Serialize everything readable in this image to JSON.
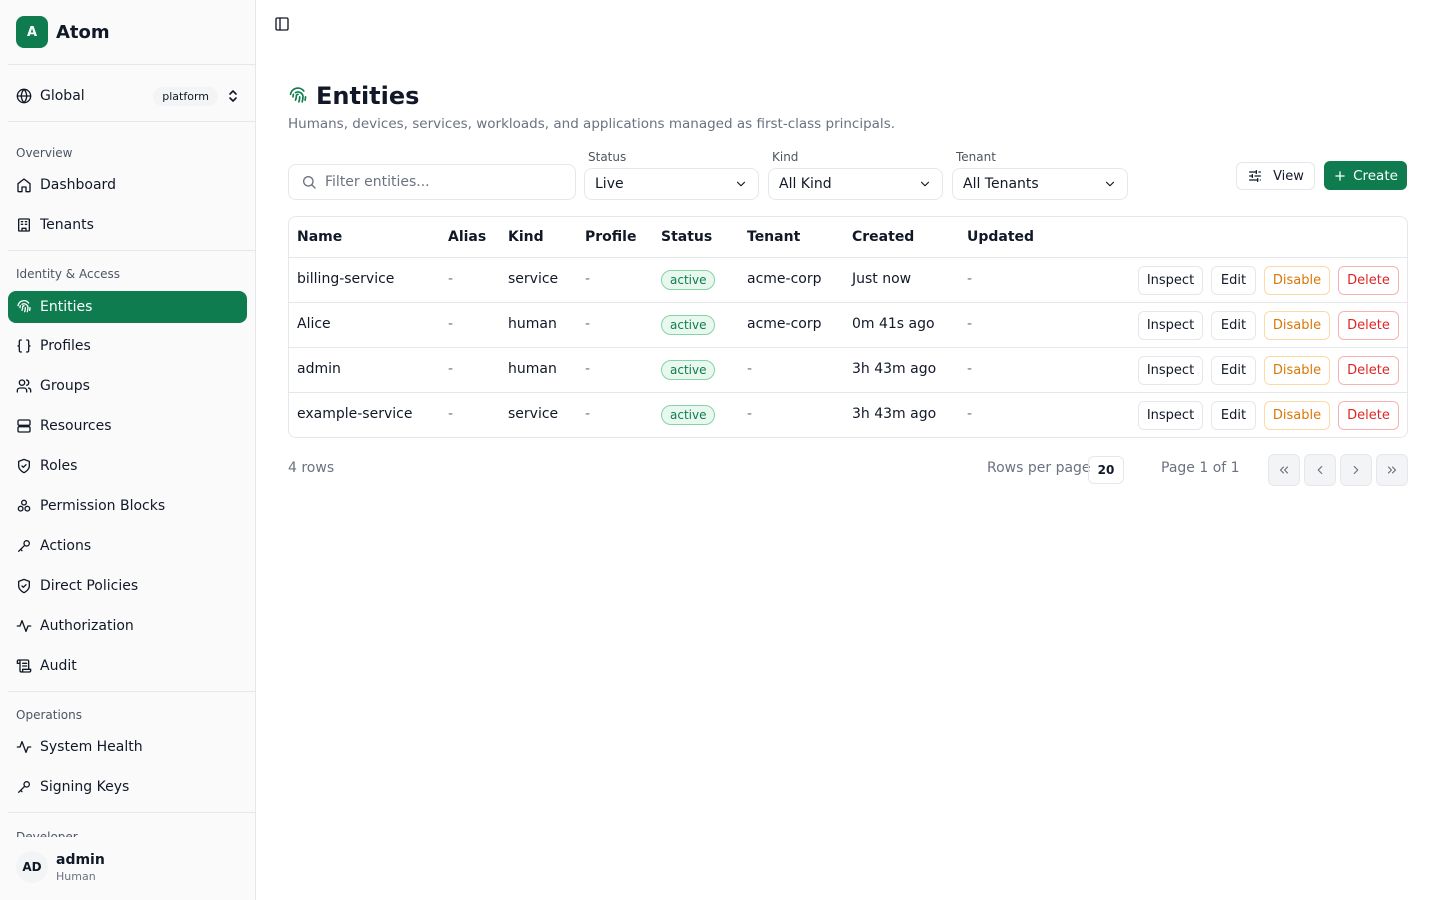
{
  "brand": {
    "logo_letter": "A",
    "name": "Atom"
  },
  "scope": {
    "label": "Global",
    "badge": "platform"
  },
  "sidebar": {
    "overview_title": "Overview",
    "overview": [
      {
        "label": "Dashboard",
        "icon": "home-icon"
      },
      {
        "label": "Tenants",
        "icon": "building-icon"
      }
    ],
    "identity_title": "Identity & Access",
    "identity": [
      {
        "label": "Entities",
        "icon": "fingerprint-icon",
        "active": true
      },
      {
        "label": "Profiles",
        "icon": "braces-icon"
      },
      {
        "label": "Groups",
        "icon": "users-icon"
      },
      {
        "label": "Resources",
        "icon": "server-icon"
      },
      {
        "label": "Roles",
        "icon": "shield-check-icon"
      },
      {
        "label": "Permission Blocks",
        "icon": "blocks-icon"
      },
      {
        "label": "Actions",
        "icon": "key-icon"
      },
      {
        "label": "Direct Policies",
        "icon": "shield-check-icon"
      },
      {
        "label": "Authorization",
        "icon": "activity-icon"
      },
      {
        "label": "Audit",
        "icon": "scroll-icon"
      }
    ],
    "operations_title": "Operations",
    "operations": [
      {
        "label": "System Health",
        "icon": "activity-icon"
      },
      {
        "label": "Signing Keys",
        "icon": "key-icon"
      }
    ],
    "developer_title_partial": "Developer"
  },
  "user": {
    "initials": "AD",
    "name": "admin",
    "kind": "Human"
  },
  "page": {
    "title": "Entities",
    "subtitle": "Humans, devices, services, workloads, and applications managed as first-class principals."
  },
  "filters": {
    "search_placeholder": "Filter entities...",
    "status": {
      "label": "Status",
      "value": "Live"
    },
    "kind": {
      "label": "Kind",
      "value": "All Kind"
    },
    "tenant": {
      "label": "Tenant",
      "value": "All Tenants"
    }
  },
  "toolbar": {
    "view_label": "View",
    "create_label": "Create"
  },
  "table": {
    "columns": [
      "Name",
      "Alias",
      "Kind",
      "Profile",
      "Status",
      "Tenant",
      "Created",
      "Updated"
    ],
    "rows": [
      {
        "name": "billing-service",
        "alias": "-",
        "kind": "service",
        "profile": "-",
        "status": "active",
        "tenant": "acme-corp",
        "created": "Just now",
        "updated": "-"
      },
      {
        "name": "Alice",
        "alias": "-",
        "kind": "human",
        "profile": "-",
        "status": "active",
        "tenant": "acme-corp",
        "created": "0m 41s ago",
        "updated": "-"
      },
      {
        "name": "admin",
        "alias": "-",
        "kind": "human",
        "profile": "-",
        "status": "active",
        "tenant": "-",
        "created": "3h 43m ago",
        "updated": "-"
      },
      {
        "name": "example-service",
        "alias": "-",
        "kind": "service",
        "profile": "-",
        "status": "active",
        "tenant": "-",
        "created": "3h 43m ago",
        "updated": "-"
      }
    ],
    "actions": {
      "inspect": "Inspect",
      "edit": "Edit",
      "disable": "Disable",
      "delete": "Delete"
    }
  },
  "footer": {
    "row_count": "4 rows",
    "rows_per_page_label": "Rows per page",
    "rows_per_page_value": "20",
    "page_info": "Page 1 of 1"
  },
  "colors": {
    "accent": "#0e7c4f",
    "active_badge_bg": "#e8f8ee",
    "disable": "#d97706",
    "delete": "#dc2626"
  }
}
